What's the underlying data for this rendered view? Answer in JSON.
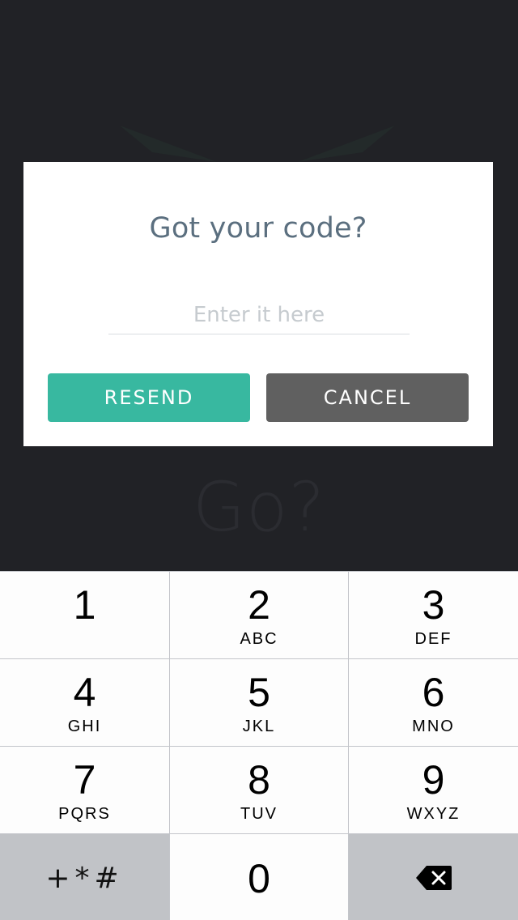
{
  "background": {
    "heading": "Go?"
  },
  "dialog": {
    "title": "Got your code?",
    "input": {
      "value": "",
      "placeholder": "Enter it here"
    },
    "resend_label": "RESEND",
    "cancel_label": "CANCEL",
    "colors": {
      "resend": "#38b8a0",
      "cancel": "#606060",
      "title": "#5b6f7f"
    }
  },
  "keypad": {
    "keys": [
      {
        "digit": "1",
        "letters": ""
      },
      {
        "digit": "2",
        "letters": "ABC"
      },
      {
        "digit": "3",
        "letters": "DEF"
      },
      {
        "digit": "4",
        "letters": "GHI"
      },
      {
        "digit": "5",
        "letters": "JKL"
      },
      {
        "digit": "6",
        "letters": "MNO"
      },
      {
        "digit": "7",
        "letters": "PQRS"
      },
      {
        "digit": "8",
        "letters": "TUV"
      },
      {
        "digit": "9",
        "letters": "WXYZ"
      }
    ],
    "symbols_label": "+*#",
    "zero": "0",
    "backspace_icon": "backspace-icon"
  }
}
